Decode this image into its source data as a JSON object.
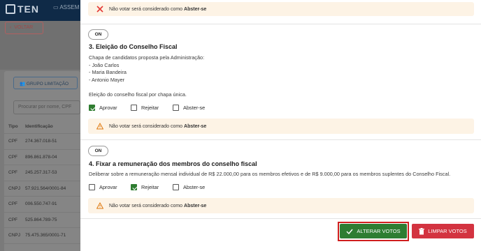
{
  "app": {
    "logo": "TEN",
    "nav_partial": "ASSEM"
  },
  "back_button": {
    "label": "VOLTAR"
  },
  "group_button": {
    "label": "GRUPO LIMITAÇÃO"
  },
  "search": {
    "placeholder": "Procurar por nome, CPF"
  },
  "table": {
    "headers": [
      "Tipo",
      "Identificação"
    ],
    "rows": [
      [
        "CPF",
        "274.367.018-51"
      ],
      [
        "CPF",
        "896.861.878-04"
      ],
      [
        "CPF",
        "245.257.317-53"
      ],
      [
        "CNPJ",
        "57.921.564/0001-84"
      ],
      [
        "CPF",
        "006.550.747-91"
      ],
      [
        "CPF",
        "525.864.789-75"
      ],
      [
        "CNPJ",
        "75.475.365/0001-71"
      ]
    ]
  },
  "warning": {
    "prefix": "Não votar será considerado como",
    "strong": "Abster-se"
  },
  "questions": [
    {
      "toggle": "ON",
      "title": "3. Eleição do Conselho Fiscal",
      "description_lines": [
        "Chapa de candidatos proposta pela Administração:",
        "- João Carlos",
        "- Maria Bandeira",
        "- Antonio Mayer",
        "",
        "Eleição do conselho fiscal por chapa única."
      ],
      "options": [
        {
          "label": "Aprovar",
          "checked": true
        },
        {
          "label": "Rejeitar",
          "checked": false
        },
        {
          "label": "Abster-se",
          "checked": false
        }
      ]
    },
    {
      "toggle": "ON",
      "title": "4. Fixar a remuneração dos membros do conselho fiscal",
      "description_lines": [
        "Deliberar sobre a remuneração mensal individual de R$ 22.000,00 para os membros efetivos e de R$ 9.000,00 para os membros suplentes do Conselho Fiscal."
      ],
      "options": [
        {
          "label": "Aprovar",
          "checked": false
        },
        {
          "label": "Rejeitar",
          "checked": true
        },
        {
          "label": "Abster-se",
          "checked": false
        }
      ]
    }
  ],
  "actions": {
    "alter_label": "ALTERAR VOTOS",
    "clear_label": "LIMPAR VOTOS"
  },
  "colors": {
    "primary_green": "#2e7d32",
    "danger_red": "#d33340",
    "warning_bg": "#fdf3e5",
    "navy": "#0f2a47"
  }
}
